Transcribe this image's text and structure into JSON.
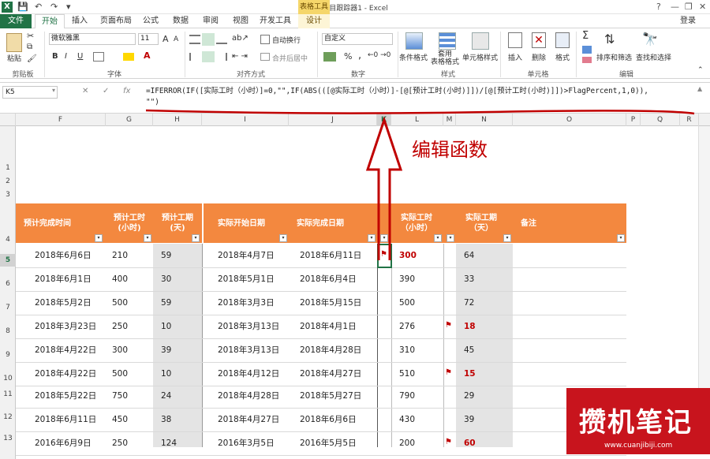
{
  "window": {
    "title": "项目跟踪器1 - Excel",
    "context_tab_group": "表格工具",
    "signin": "登录"
  },
  "ribbon_tabs": [
    "文件",
    "开始",
    "插入",
    "页面布局",
    "公式",
    "数据",
    "审阅",
    "视图",
    "开发工具",
    "设计"
  ],
  "ribbon": {
    "clipboard": {
      "paste": "粘贴",
      "group": "剪贴板"
    },
    "font": {
      "name": "微软雅黑",
      "size": "11",
      "group": "字体",
      "bold": "B",
      "italic": "I",
      "underline": "U",
      "grow": "A",
      "shrink": "A"
    },
    "alignment": {
      "wrap": "自动换行",
      "merge": "合并后居中",
      "group": "对齐方式"
    },
    "number": {
      "format": "自定义",
      "group": "数字",
      "percent": "%",
      "comma": ","
    },
    "styles": {
      "conditional": "条件格式",
      "table": "套用\n表格格式",
      "cell_styles": "单元格样式",
      "group": "样式"
    },
    "cells": {
      "insert": "插入",
      "delete": "删除",
      "format": "格式",
      "group": "单元格"
    },
    "editing": {
      "sort": "排序和筛选",
      "find": "查找和选择",
      "group": "编辑"
    }
  },
  "formula_bar": {
    "name_box": "K5",
    "fx": "fx",
    "formula": "=IFERROR(IF([实际工时（小时）]=0,\"\",IF(ABS(([@实际工时（小时）]-[@[预计工时(小时)]])/[@[预计工时(小时)]])>FlagPercent,1,0)),\n\"\")"
  },
  "columns": [
    "F",
    "G",
    "H",
    "I",
    "J",
    "K",
    "L",
    "M",
    "N",
    "O",
    "P",
    "Q",
    "R"
  ],
  "rows": [
    "1",
    "2",
    "3",
    "4",
    "5",
    "6",
    "7",
    "8",
    "9",
    "10",
    "11",
    "12",
    "13"
  ],
  "table_headers": {
    "est_finish": "预计完成时间",
    "est_hours": "预计工时\n(小时)",
    "est_days": "预计工期\n(天)",
    "act_start": "实际开始日期",
    "act_finish": "实际完成日期",
    "act_hours": "实际工时\n（小时）",
    "act_days": "实际工期\n（天）",
    "notes": "备注"
  },
  "table_rows": [
    {
      "est_finish": "2018年6月6日",
      "est_hours": "210",
      "est_days": "59",
      "act_start": "2018年4月7日",
      "act_finish": "2018年6月11日",
      "flag_k": true,
      "act_hours": "300",
      "hours_red": true,
      "flag_m": false,
      "act_days": "64",
      "days_red": false
    },
    {
      "est_finish": "2018年6月1日",
      "est_hours": "400",
      "est_days": "30",
      "act_start": "2018年5月1日",
      "act_finish": "2018年6月4日",
      "flag_k": false,
      "act_hours": "390",
      "hours_red": false,
      "flag_m": false,
      "act_days": "33",
      "days_red": false
    },
    {
      "est_finish": "2018年5月2日",
      "est_hours": "500",
      "est_days": "59",
      "act_start": "2018年3月3日",
      "act_finish": "2018年5月15日",
      "flag_k": false,
      "act_hours": "500",
      "hours_red": false,
      "flag_m": false,
      "act_days": "72",
      "days_red": false
    },
    {
      "est_finish": "2018年3月23日",
      "est_hours": "250",
      "est_days": "10",
      "act_start": "2018年3月13日",
      "act_finish": "2018年4月1日",
      "flag_k": false,
      "act_hours": "276",
      "hours_red": false,
      "flag_m": true,
      "act_days": "18",
      "days_red": true
    },
    {
      "est_finish": "2018年4月22日",
      "est_hours": "300",
      "est_days": "39",
      "act_start": "2018年3月13日",
      "act_finish": "2018年4月28日",
      "flag_k": false,
      "act_hours": "310",
      "hours_red": false,
      "flag_m": false,
      "act_days": "45",
      "days_red": false
    },
    {
      "est_finish": "2018年4月22日",
      "est_hours": "500",
      "est_days": "10",
      "act_start": "2018年4月12日",
      "act_finish": "2018年4月27日",
      "flag_k": false,
      "act_hours": "510",
      "hours_red": false,
      "flag_m": true,
      "act_days": "15",
      "days_red": true
    },
    {
      "est_finish": "2018年5月22日",
      "est_hours": "750",
      "est_days": "24",
      "act_start": "2018年4月28日",
      "act_finish": "2018年5月27日",
      "flag_k": false,
      "act_hours": "790",
      "hours_red": false,
      "flag_m": false,
      "act_days": "29",
      "days_red": false
    },
    {
      "est_finish": "2018年6月11日",
      "est_hours": "450",
      "est_days": "38",
      "act_start": "2018年4月27日",
      "act_finish": "2018年6月6日",
      "flag_k": false,
      "act_hours": "430",
      "hours_red": false,
      "flag_m": false,
      "act_days": "39",
      "days_red": false
    },
    {
      "est_finish": "2016年6月9日",
      "est_hours": "250",
      "est_days": "124",
      "act_start": "2016年3月5日",
      "act_finish": "2016年5月5日",
      "flag_k": false,
      "act_hours": "200",
      "hours_red": false,
      "flag_m": true,
      "act_days": "60",
      "days_red": true
    }
  ],
  "annotation": "编辑函数",
  "watermark": {
    "text": "攒机笔记",
    "url": "www.cuanjibiji.com"
  },
  "colors": {
    "excel_green": "#217346",
    "header_orange": "#f3883f",
    "accent_red": "#c00000",
    "shade_gray": "#e4e4e4"
  }
}
